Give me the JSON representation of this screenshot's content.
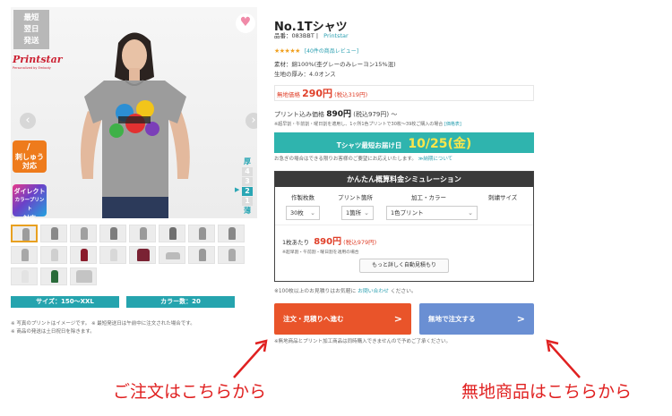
{
  "photo": {
    "next_day_lines": [
      "最短",
      "翌日",
      "発送"
    ],
    "brand_logo": "Printstar",
    "brand_tagline": "Personalized by Embody",
    "badge_embroidery": [
      "刺しゅう",
      "対応"
    ],
    "badge_dtf": [
      "ダイレクト",
      "カラープリント",
      "対応"
    ],
    "thickness_label_top": "厚",
    "thickness_levels": [
      "4",
      "3",
      "2",
      "1"
    ],
    "thickness_label_bottom": "薄",
    "thickness_active": "2"
  },
  "specs": {
    "size": "サイズ：150〜XXL",
    "colors": "カラー数：20"
  },
  "left_notes": [
    "※ 写真のプリントはイメージです。 ※ 最短発送日は午前中に注文された場合です。",
    "※ 商品の発送は土日祝日を除きます。"
  ],
  "product": {
    "title": "No.1Tシャツ",
    "code": "品番：083BBT",
    "maker": "Printstar",
    "stars": "★★★★★",
    "reviews": "[40件の商品レビュー]",
    "material": "素材：綿100%(杢グレーのみレーヨン15%混)",
    "thickness": "生地の厚み：4.0オンス"
  },
  "blank_price": {
    "label": "無地価格",
    "price": "290円",
    "tax": "(税込319円)"
  },
  "print_price": {
    "label": "プリント込み価格",
    "price": "890円",
    "tax": "(税込979円)",
    "suffix": "〜",
    "note": "※超早割・午前割・曜日割を適用し、1ヶ所1色プリントで30枚〜39枚ご購入の場合",
    "note_link": "[価格表]"
  },
  "delivery": {
    "label": "Tシャツ最短お届け日",
    "date": "10/25(金)",
    "note": "お急ぎの場合はできる限りお客様のご要望にお応えいたします。",
    "note_link": "≫納期について"
  },
  "simulation": {
    "title": "かんたん概算料金シミュレーション",
    "columns": [
      "作製枚数",
      "プリント箇所",
      "加工・カラー",
      "刺繍サイズ"
    ],
    "qty_value": "30枚",
    "place_value": "1箇所",
    "color_value": "1色プリント",
    "unit_label": "1枚あたり",
    "unit_price": "890円",
    "unit_tax": "(税込979円)",
    "note": "※超早割・午前割・曜日割を適用の場合",
    "detail_button": "もっと詳しく自動見積もり"
  },
  "min_note": "※100枚以上のお見積りはお気軽に",
  "min_note_link": "お問い合わせ",
  "min_note_end": "ください。",
  "buttons": {
    "order": "注文・見積りへ進む",
    "blank": "無地で注文する",
    "chevron": ">"
  },
  "cta_note": "※無地商品とプリント加工商品は同時購入できませんので予めご了承ください。",
  "annotations": {
    "left": "ご注文はこちらから",
    "right": "無地商品はこちらから"
  },
  "colors": {
    "accent_teal": "#2fb4ae",
    "order_orange": "#e9542a",
    "blank_blue": "#6a8fd3",
    "price_red": "#e0402a",
    "annotation_red": "#e02121"
  }
}
